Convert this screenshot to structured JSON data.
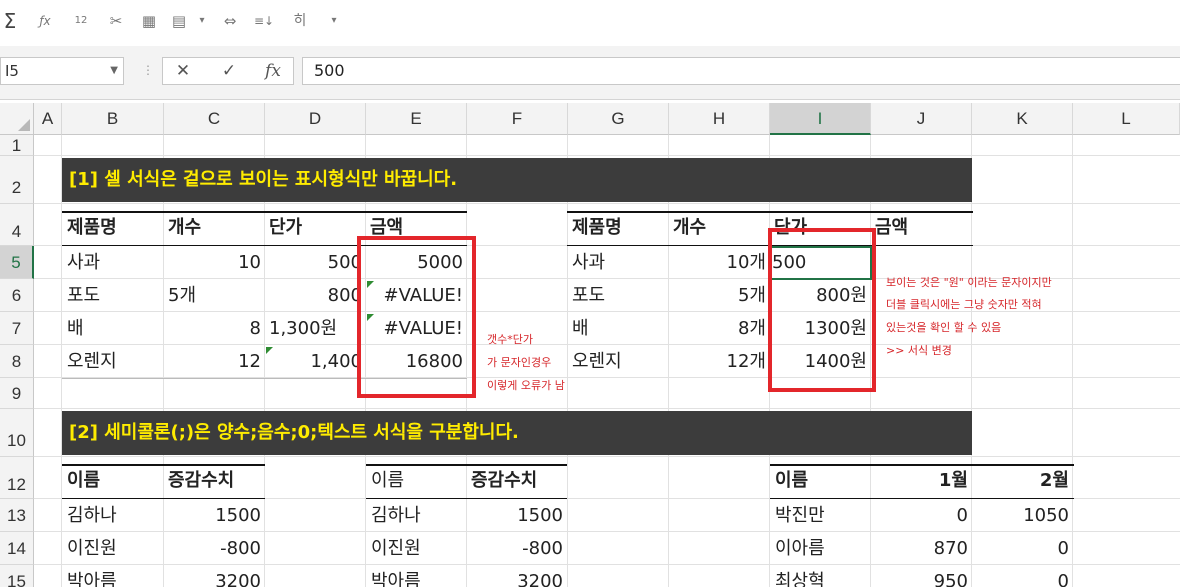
{
  "toolbar": {
    "icons": [
      "sum-icon",
      "insert-function-icon",
      "number-format-icon",
      "paste-format-icon",
      "grid-icon",
      "merge-icon",
      "merge-dropdown-icon",
      "fit-width-icon",
      "sort-icon",
      "filter-icon",
      "customize-icon"
    ],
    "glyphs": [
      "Σ",
      "ƒx",
      "12",
      "✂",
      "▦",
      "▤",
      "▾",
      "⇔",
      "≡↓",
      "히",
      "▾"
    ]
  },
  "formula_bar": {
    "name_box": "I5",
    "cancel": "✕",
    "enter": "✓",
    "fx": "fx",
    "value": "500"
  },
  "columns": [
    "A",
    "B",
    "C",
    "D",
    "E",
    "F",
    "G",
    "H",
    "I",
    "J",
    "K",
    "L"
  ],
  "selected_column": "I",
  "rows": [
    "1",
    "2",
    "4",
    "5",
    "6",
    "7",
    "8",
    "9",
    "10",
    "12",
    "13",
    "14",
    "15"
  ],
  "selected_row": "5",
  "banners": {
    "b1": "[1] 셀 서식은 겉으로 보이는 표시형식만 바꿉니다.",
    "b2": "[2] 세미콜론(;)은 양수;음수;0;텍스트 서식을 구분합니다."
  },
  "table1": {
    "headers": [
      "제품명",
      "개수",
      "단가",
      "금액"
    ],
    "rows": [
      [
        "사과",
        "10",
        "500",
        "5000"
      ],
      [
        "포도",
        "5개",
        "800",
        "#VALUE!"
      ],
      [
        "배",
        "8",
        "1,300원",
        "#VALUE!"
      ],
      [
        "오렌지",
        "12",
        "1,400",
        "16800"
      ]
    ]
  },
  "table2": {
    "headers": [
      "제품명",
      "개수",
      "단가",
      "금액"
    ],
    "rows": [
      [
        "사과",
        "10개",
        "500",
        ""
      ],
      [
        "포도",
        "5개",
        "800원",
        ""
      ],
      [
        "배",
        "8개",
        "1300원",
        ""
      ],
      [
        "오렌지",
        "12개",
        "1400원",
        ""
      ]
    ]
  },
  "note_left": [
    "갯수*단가",
    "가 문자인경우",
    "이렇게 오류가 남"
  ],
  "note_right": [
    "보이는 것은 \"원\" 이라는 문자이지만",
    "더블 클릭시에는 그냥 숫자만 적혀",
    "있는것을 확인 할 수 있음",
    ">> 서식 변경"
  ],
  "table3": {
    "headers": [
      "이름",
      "증감수치"
    ],
    "rows": [
      [
        "김하나",
        "1500"
      ],
      [
        "이진원",
        "-800"
      ],
      [
        "박아름",
        "3200"
      ]
    ]
  },
  "table4": {
    "headers": [
      "이름",
      "증감수치"
    ],
    "rows": [
      [
        "김하나",
        "1500"
      ],
      [
        "이진원",
        "-800"
      ],
      [
        "박아름",
        "3200"
      ]
    ]
  },
  "table5": {
    "headers": [
      "이름",
      "1월",
      "2월"
    ],
    "rows": [
      [
        "박진만",
        "0",
        "1050"
      ],
      [
        "이아름",
        "870",
        "0"
      ],
      [
        "최상혁",
        "950",
        "0"
      ]
    ]
  },
  "colors": {
    "banner_bg": "#3c3c3c",
    "banner_text": "#ffec00",
    "annotation": "#e3262b",
    "select_green": "#217346"
  }
}
